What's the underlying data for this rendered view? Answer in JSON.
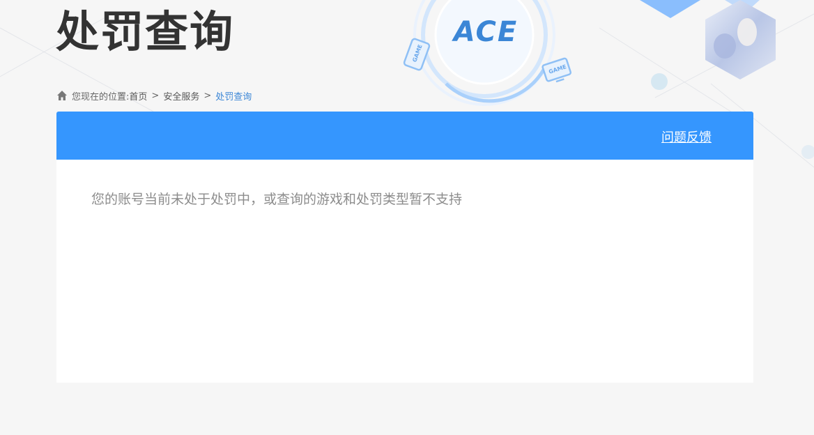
{
  "page": {
    "title": "处罚查询"
  },
  "logo": {
    "text": "ACE",
    "badge_text": "GAME"
  },
  "breadcrumb": {
    "prefix": "您现在的位置:",
    "items": [
      "首页",
      "安全服务",
      "处罚查询"
    ],
    "separator": ">"
  },
  "panel": {
    "feedback_label": "问题反馈",
    "message": "您的账号当前未处于处罚中，或查询的游戏和处罚类型暂不支持"
  },
  "colors": {
    "header_blue": "#3596fe",
    "breadcrumb_current": "#3b86d6",
    "title": "#333333",
    "message": "#8c8c8c",
    "background": "#f6f6f6"
  }
}
